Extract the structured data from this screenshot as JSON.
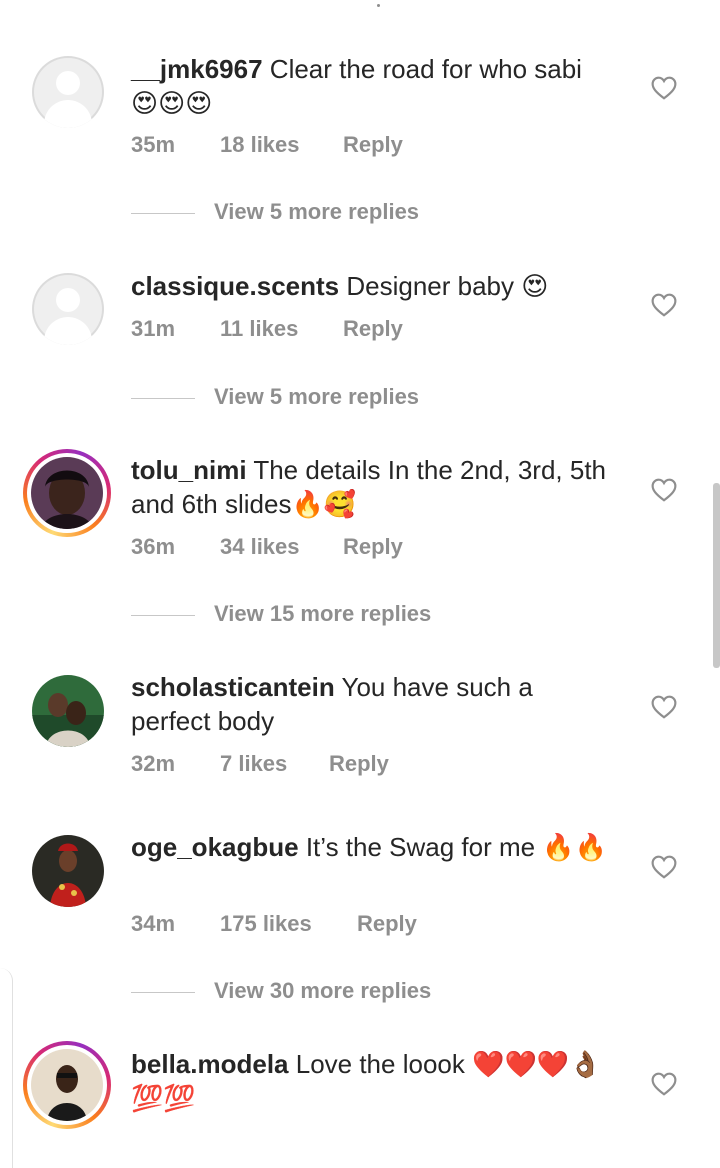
{
  "comments": [
    {
      "username": "__jmk6967",
      "text": "Clear the road for who sabi 😍😍😍",
      "time": "35m",
      "likes": "18 likes",
      "reply": "Reply",
      "view_replies": "View 5 more replies",
      "avatar": "default-avatar"
    },
    {
      "username": "classique.scents",
      "text": "Designer baby 😍",
      "time": "31m",
      "likes": "11 likes",
      "reply": "Reply",
      "view_replies": "View 5 more replies",
      "avatar": "default-avatar"
    },
    {
      "username": "tolu_nimi",
      "text": "The details In the 2nd, 3rd, 5th and 6th slides🔥🥰",
      "time": "36m",
      "likes": "34 likes",
      "reply": "Reply",
      "view_replies": "View 15 more replies",
      "avatar": "photo-avatar-story"
    },
    {
      "username": "scholasticantein",
      "text": "You have such a perfect body",
      "time": "32m",
      "likes": "7 likes",
      "reply": "Reply",
      "avatar": "photo-avatar"
    },
    {
      "username": "oge_okagbue",
      "text": "It’s the Swag for me 🔥🔥",
      "time": "34m",
      "likes": "175 likes",
      "reply": "Reply",
      "view_replies": "View 30 more replies",
      "avatar": "photo-avatar"
    },
    {
      "username": "bella.modela",
      "text": "Love the loook ❤️❤️❤️👌🏾💯💯",
      "avatar": "photo-avatar-story"
    }
  ],
  "icons": {
    "like": "heart-outline-icon"
  },
  "colors": {
    "text": "#262626",
    "meta": "#8e8e8e",
    "story_ring_start": "#feda75",
    "story_ring_end": "#962fbf"
  }
}
